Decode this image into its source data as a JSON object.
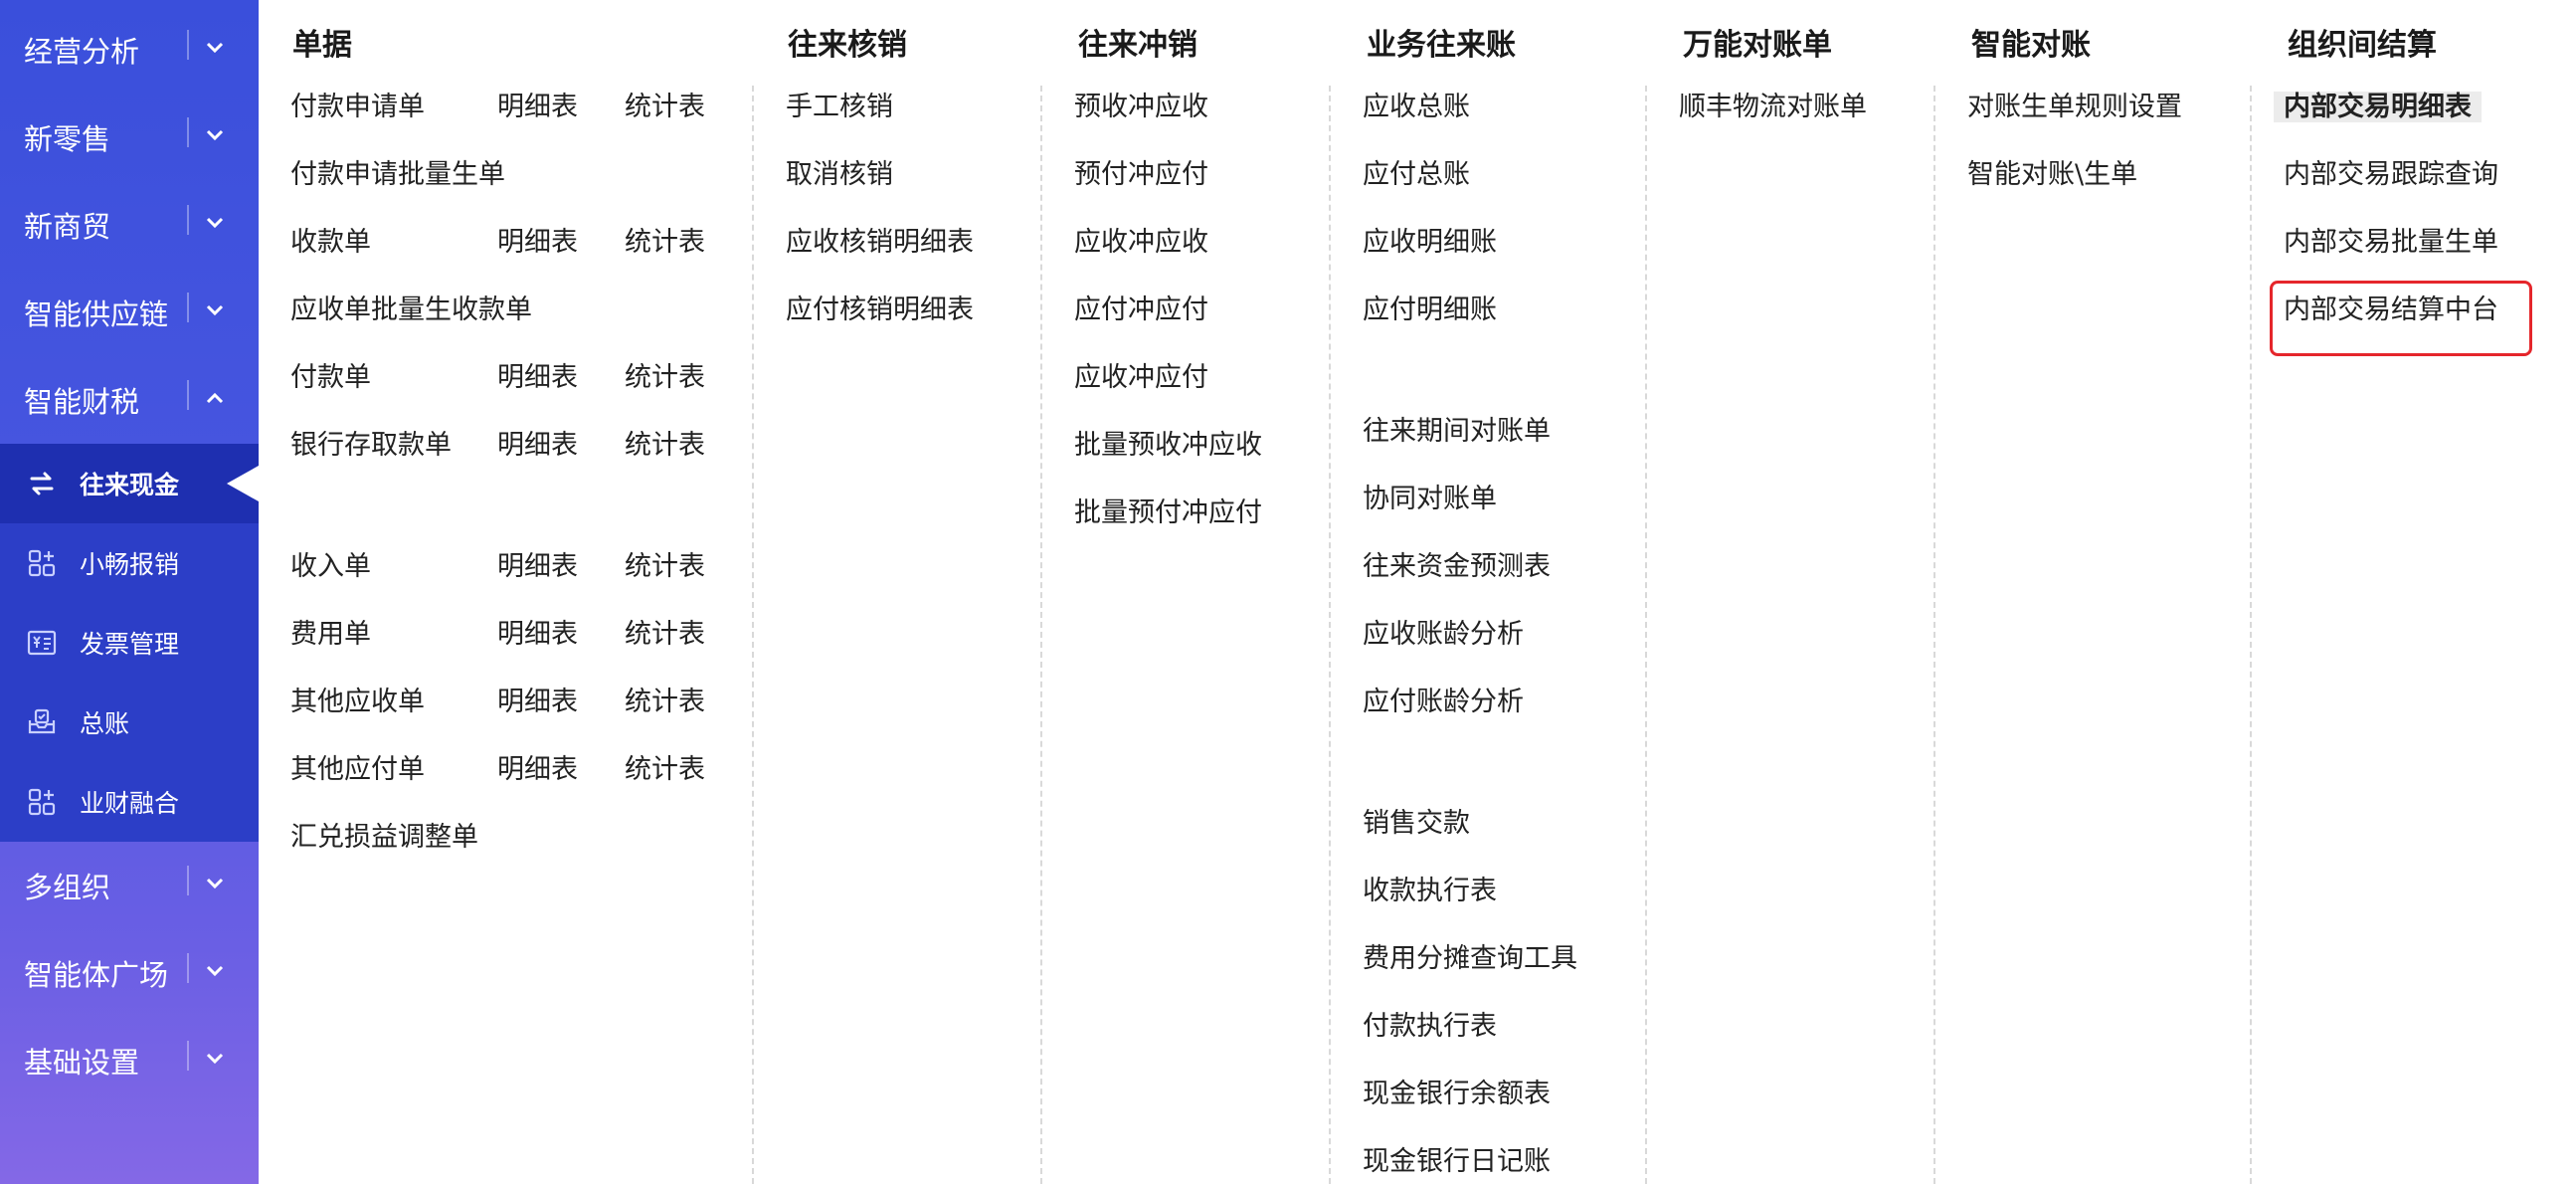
{
  "sidebar": {
    "top_items": [
      {
        "label": "经营分析",
        "expanded": false
      },
      {
        "label": "新零售",
        "expanded": false
      },
      {
        "label": "新商贸",
        "expanded": false
      },
      {
        "label": "智能供应链",
        "expanded": false
      },
      {
        "label": "智能财税",
        "expanded": true
      }
    ],
    "sub_items": [
      {
        "label": "往来现金",
        "icon": "exchange-arrows-icon",
        "active": true
      },
      {
        "label": "小畅报销",
        "icon": "grid-plus-icon",
        "active": false
      },
      {
        "label": "发票管理",
        "icon": "invoice-yen-icon",
        "active": false
      },
      {
        "label": "总账",
        "icon": "ledger-tray-icon",
        "active": false
      },
      {
        "label": "业财融合",
        "icon": "grid-plus-icon",
        "active": false
      }
    ],
    "bottom_items": [
      {
        "label": "多组织",
        "expanded": false
      },
      {
        "label": "智能体广场",
        "expanded": false
      },
      {
        "label": "基础设置",
        "expanded": false
      }
    ]
  },
  "menu": {
    "documents": {
      "title": "单据",
      "rows": [
        {
          "name": "付款申请单",
          "detail": "明细表",
          "stats": "统计表"
        },
        {
          "name": "付款申请批量生单",
          "detail": "",
          "stats": ""
        },
        {
          "name": "收款单",
          "detail": "明细表",
          "stats": "统计表"
        },
        {
          "name": "应收单批量生收款单",
          "detail": "",
          "stats": ""
        },
        {
          "name": "付款单",
          "detail": "明细表",
          "stats": "统计表"
        },
        {
          "name": "银行存取款单",
          "detail": "明细表",
          "stats": "统计表"
        },
        {
          "name": "收入单",
          "detail": "明细表",
          "stats": "统计表"
        },
        {
          "name": "费用单",
          "detail": "明细表",
          "stats": "统计表"
        },
        {
          "name": "其他应收单",
          "detail": "明细表",
          "stats": "统计表"
        },
        {
          "name": "其他应付单",
          "detail": "明细表",
          "stats": "统计表"
        },
        {
          "name": "汇兑损益调整单",
          "detail": "",
          "stats": ""
        }
      ]
    },
    "writeoff": {
      "title": "往来核销",
      "items": [
        "手工核销",
        "取消核销",
        "应收核销明细表",
        "应付核销明细表"
      ]
    },
    "offset": {
      "title": "往来冲销",
      "items": [
        "预收冲应收",
        "预付冲应付",
        "应收冲应收",
        "应付冲应付",
        "应收冲应付",
        "批量预收冲应收",
        "批量预付冲应付"
      ]
    },
    "accounts": {
      "title": "业务往来账",
      "items": [
        "应收总账",
        "应付总账",
        "应收明细账",
        "应付明细账",
        "往来期间对账单",
        "协同对账单",
        "往来资金预测表",
        "应收账龄分析",
        "应付账龄分析",
        "销售交款",
        "收款执行表",
        "费用分摊查询工具",
        "付款执行表",
        "现金银行余额表",
        "现金银行日记账"
      ]
    },
    "universal": {
      "title": "万能对账单",
      "items": [
        "顺丰物流对账单"
      ]
    },
    "smart": {
      "title": "智能对账",
      "items": [
        "对账生单规则设置",
        "智能对账\\生单"
      ]
    },
    "inter_org": {
      "title": "组织间结算",
      "items": [
        "内部交易明细表",
        "内部交易跟踪查询",
        "内部交易批量生单",
        "内部交易结算中台"
      ]
    }
  },
  "colors": {
    "accent": "#3a4fdb",
    "highlight_box": "#e5262b",
    "active_sub": "#1e2fb0"
  }
}
